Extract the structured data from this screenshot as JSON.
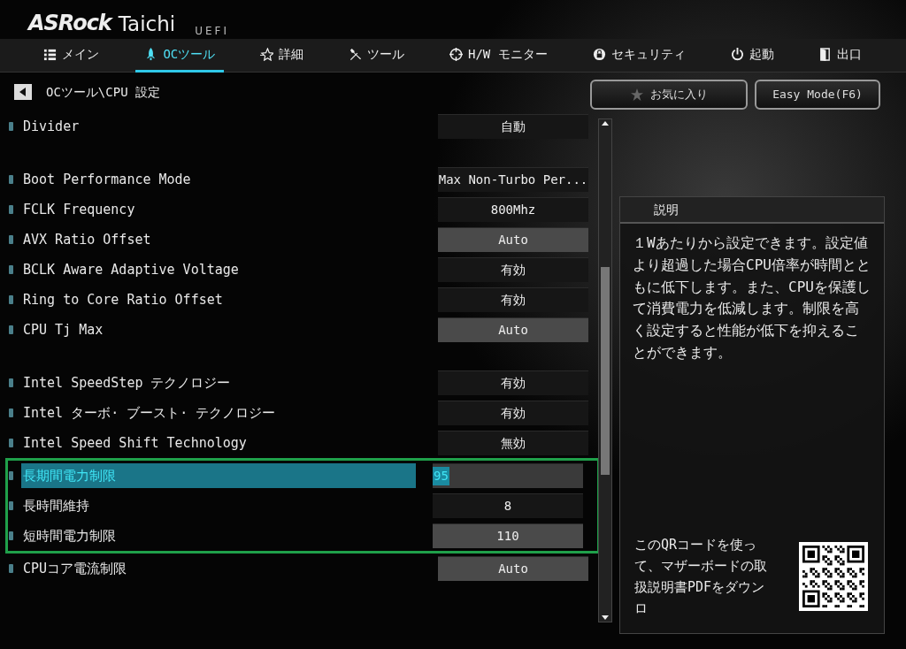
{
  "logo": {
    "brand": "ASRock",
    "model": "Taichi",
    "edition": "UEFI"
  },
  "tabs": [
    {
      "label": "メイン",
      "selected": false
    },
    {
      "label": "OCツール",
      "selected": true
    },
    {
      "label": "詳細",
      "selected": false
    },
    {
      "label": "ツール",
      "selected": false
    },
    {
      "label": "H/W モニター",
      "selected": false
    },
    {
      "label": "セキュリティ",
      "selected": false
    },
    {
      "label": "起動",
      "selected": false
    },
    {
      "label": "出口",
      "selected": false
    }
  ],
  "breadcrumb": "OCツール\\CPU 設定",
  "favorites_button": "お気に入り",
  "easy_mode_button": "Easy Mode(F6)",
  "settings": [
    {
      "kind": "item",
      "label": "Divider",
      "value": "自動",
      "field": false,
      "selected": false,
      "outlined": false
    },
    {
      "kind": "blank"
    },
    {
      "kind": "item",
      "label": "Boot Performance Mode",
      "value": "Max Non-Turbo Per...",
      "field": false,
      "selected": false,
      "outlined": false
    },
    {
      "kind": "item",
      "label": "FCLK Frequency",
      "value": "800Mhz",
      "field": false,
      "selected": false,
      "outlined": false
    },
    {
      "kind": "item",
      "label": "AVX Ratio Offset",
      "value": "Auto",
      "field": true,
      "selected": false,
      "outlined": false
    },
    {
      "kind": "item",
      "label": "BCLK Aware Adaptive Voltage",
      "value": "有効",
      "field": false,
      "selected": false,
      "outlined": false
    },
    {
      "kind": "item",
      "label": "Ring to Core Ratio Offset",
      "value": "有効",
      "field": false,
      "selected": false,
      "outlined": false
    },
    {
      "kind": "item",
      "label": "CPU Tj Max",
      "value": "Auto",
      "field": true,
      "selected": false,
      "outlined": false
    },
    {
      "kind": "blank"
    },
    {
      "kind": "item",
      "label": "Intel SpeedStep テクノロジー",
      "value": "有効",
      "field": false,
      "selected": false,
      "outlined": false
    },
    {
      "kind": "item",
      "label": "Intel ターボ· ブースト· テクノロジー",
      "value": "有効",
      "field": false,
      "selected": false,
      "outlined": false
    },
    {
      "kind": "item",
      "label": "Intel Speed Shift Technology",
      "value": "無効",
      "field": false,
      "selected": false,
      "outlined": false
    },
    {
      "kind": "item",
      "label": "長期間電力制限",
      "value": "95",
      "field": true,
      "selected": true,
      "outlined": true
    },
    {
      "kind": "item",
      "label": "長時間維持",
      "value": "8",
      "field": false,
      "selected": false,
      "outlined": true
    },
    {
      "kind": "item",
      "label": "短時間電力制限",
      "value": "110",
      "field": true,
      "selected": false,
      "outlined": true
    },
    {
      "kind": "item",
      "label": "CPUコア電流制限",
      "value": "Auto",
      "field": true,
      "selected": false,
      "outlined": false
    }
  ],
  "description": {
    "title": "説明",
    "text": "１Wあたりから設定できます。設定値より超過した場合CPU倍率が時間とともに低下します。また、CPUを保護して消費電力を低減します。制限を高く設定すると性能が低下を抑えることができます。"
  },
  "qr_text": "このQRコードを使って、マザーボードの取扱説明書PDFをダウンロ"
}
